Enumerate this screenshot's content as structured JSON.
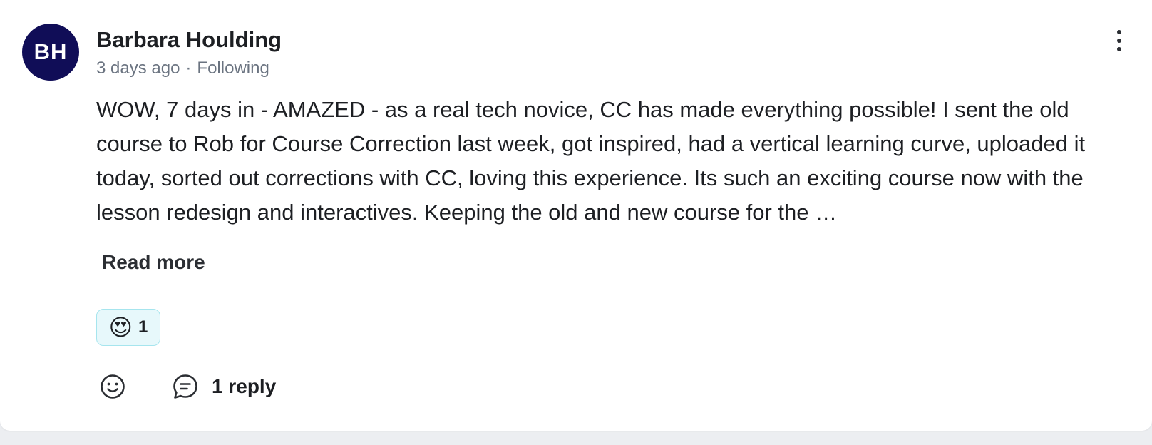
{
  "post": {
    "author": {
      "initials": "BH",
      "name": "Barbara Houlding",
      "avatar_color": "#100d57"
    },
    "meta": {
      "time": "3 days ago",
      "separator": "·",
      "follow_status": "Following"
    },
    "body": "WOW, 7 days in - AMAZED - as a real tech novice, CC has made everything possible! I sent the old course to Rob for Course Correction last week, got inspired, had a vertical learning curve, uploaded it today, sorted out corrections with CC, loving this experience. Its such an exciting course now with the lesson redesign and interactives. Keeping the old and new course for the …",
    "read_more_label": "Read more",
    "reactions": [
      {
        "emoji": "😍",
        "icon": "heart-eyes-emoji",
        "count": "1"
      }
    ],
    "actions": {
      "react_icon": "smiley-icon",
      "reply_icon": "comment-bubble-icon",
      "reply_label": "1 reply"
    },
    "menu_icon": "more-vertical-icon"
  }
}
